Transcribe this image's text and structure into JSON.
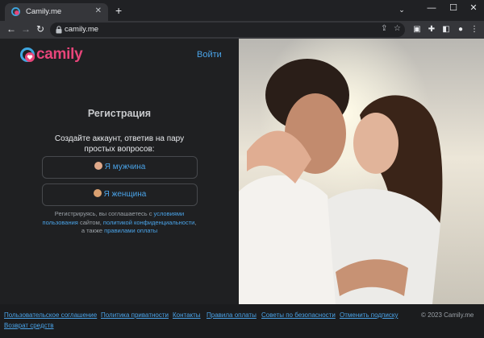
{
  "browser": {
    "tab_title": "Camily.me",
    "new_tab": "+",
    "url": "camily.me"
  },
  "header": {
    "logo_text": "camily",
    "login_label": "Войти"
  },
  "registration": {
    "title": "Регистрация",
    "subtitle": "Создайте аккаунт, ответив на пару простых вопросов:",
    "male_label": "Я мужчина",
    "female_label": "Я женщина",
    "terms": {
      "part1": "Регистрируясь, вы соглашаетесь с ",
      "link_terms": "условиями пользования",
      "part2": " сайтом, ",
      "link_privacy": "политикой конфиденциальности",
      "part3": ", а также ",
      "link_payment": "правилами оплаты"
    }
  },
  "footer": {
    "links": [
      "Пользовательское соглашение",
      "Политика приватности",
      "Контакты",
      "Правила оплаты",
      "Советы по безопасности",
      "Отменить подписку",
      "Возврат средств"
    ],
    "copyright": "© 2023 Camily.me"
  },
  "colors": {
    "accent_pink": "#e8457a",
    "link_blue": "#4aa3e8",
    "page_bg": "#1f2022"
  },
  "icons": [
    "camily-favicon",
    "close-icon",
    "back-arrow-icon",
    "forward-arrow-icon",
    "reload-icon",
    "lock-icon",
    "share-icon",
    "star-icon",
    "extension-icon",
    "puzzle-icon",
    "sidebar-icon",
    "menu-dots-icon"
  ]
}
